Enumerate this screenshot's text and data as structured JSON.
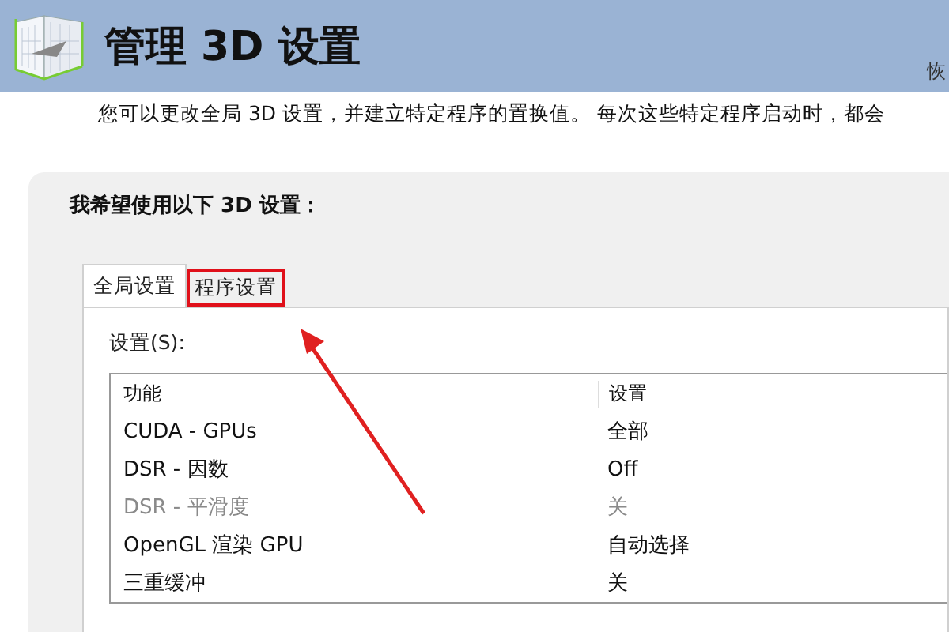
{
  "header": {
    "title": "管理 3D 设置",
    "restore_link": "恢"
  },
  "description": "您可以更改全局 3D 设置，并建立特定程序的置换值。 每次这些特定程序启动时，都会",
  "panel": {
    "heading": "我希望使用以下 3D 设置：",
    "tabs": [
      {
        "label": "全局设置",
        "selected": true,
        "highlighted": false
      },
      {
        "label": "程序设置",
        "selected": false,
        "highlighted": true
      }
    ],
    "settings_label": "设置(S):",
    "table": {
      "columns": [
        "功能",
        "设置"
      ],
      "rows": [
        {
          "feature": "CUDA - GPUs",
          "value": "全部",
          "disabled": false
        },
        {
          "feature": "DSR - 因数",
          "value": "Off",
          "disabled": false
        },
        {
          "feature": "DSR - 平滑度",
          "value": "关",
          "disabled": true
        },
        {
          "feature": "OpenGL 渲染 GPU",
          "value": "自动选择",
          "disabled": false
        },
        {
          "feature": "三重缓冲",
          "value": "关",
          "disabled": false
        }
      ]
    }
  }
}
